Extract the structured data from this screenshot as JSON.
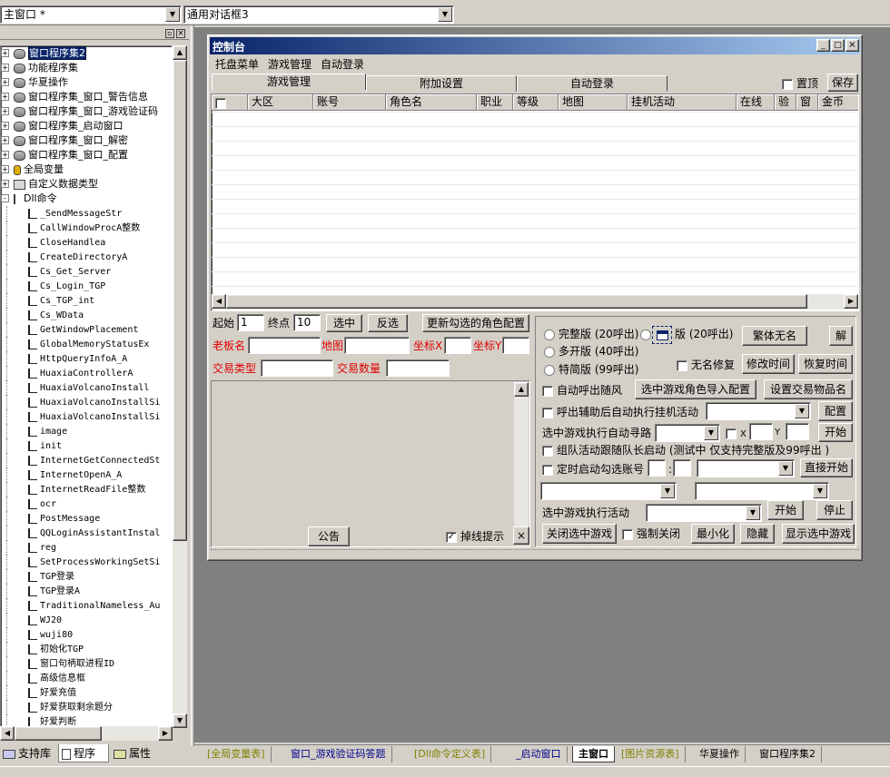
{
  "toolbar": {
    "window_select": "主窗口 *",
    "dialog_select": "通用对话框3"
  },
  "tree": {
    "items": [
      {
        "label": "窗口程序集2",
        "level": 0,
        "icon": "module-icon",
        "expand": "+",
        "selected": true
      },
      {
        "label": "功能程序集",
        "level": 0,
        "icon": "module-icon",
        "expand": "+"
      },
      {
        "label": "华夏操作",
        "level": 0,
        "icon": "module-icon",
        "expand": "+"
      },
      {
        "label": "窗口程序集_窗口_警告信息",
        "level": 0,
        "icon": "module-icon",
        "expand": "+"
      },
      {
        "label": "窗口程序集_窗口_游戏验证码",
        "level": 0,
        "icon": "module-icon",
        "expand": "+"
      },
      {
        "label": "窗口程序集_启动窗口",
        "level": 0,
        "icon": "module-icon",
        "expand": "+"
      },
      {
        "label": "窗口程序集_窗口_解密",
        "level": 0,
        "icon": "module-icon",
        "expand": "+"
      },
      {
        "label": "窗口程序集_窗口_配置",
        "level": 0,
        "icon": "module-icon",
        "expand": "+"
      },
      {
        "label": "全局变量",
        "level": 0,
        "icon": "database-icon",
        "expand": "+"
      },
      {
        "label": "自定义数据类型",
        "level": 0,
        "icon": "datatype-icon",
        "expand": "+"
      },
      {
        "label": "Dll命令",
        "level": 0,
        "icon": "dll-icon",
        "expand": "-"
      },
      {
        "label": "_SendMessageStr",
        "level": 1,
        "mono": true
      },
      {
        "label": "CallWindowProcA整数",
        "level": 1,
        "mono": true
      },
      {
        "label": "CloseHandlea",
        "level": 1,
        "mono": true
      },
      {
        "label": "CreateDirectoryA",
        "level": 1,
        "mono": true
      },
      {
        "label": "Cs_Get_Server",
        "level": 1,
        "mono": true
      },
      {
        "label": "Cs_Login_TGP",
        "level": 1,
        "mono": true
      },
      {
        "label": "Cs_TGP_int",
        "level": 1,
        "mono": true
      },
      {
        "label": "Cs_WData",
        "level": 1,
        "mono": true
      },
      {
        "label": "GetWindowPlacement",
        "level": 1,
        "mono": true
      },
      {
        "label": "GlobalMemoryStatusEx",
        "level": 1,
        "mono": true
      },
      {
        "label": "HttpQueryInfoA_A",
        "level": 1,
        "mono": true
      },
      {
        "label": "HuaxiaControllerA",
        "level": 1,
        "mono": true
      },
      {
        "label": "HuaxiaVolcanoInstall",
        "level": 1,
        "mono": true
      },
      {
        "label": "HuaxiaVolcanoInstallSi",
        "level": 1,
        "mono": true
      },
      {
        "label": "HuaxiaVolcanoInstallSi",
        "level": 1,
        "mono": true
      },
      {
        "label": "image",
        "level": 1,
        "mono": true
      },
      {
        "label": "init",
        "level": 1,
        "mono": true
      },
      {
        "label": "InternetGetConnectedSt",
        "level": 1,
        "mono": true
      },
      {
        "label": "InternetOpenA_A",
        "level": 1,
        "mono": true
      },
      {
        "label": "InternetReadFile整数",
        "level": 1,
        "mono": true
      },
      {
        "label": "ocr",
        "level": 1,
        "mono": true
      },
      {
        "label": "PostMessage",
        "level": 1,
        "mono": true
      },
      {
        "label": "QQLoginAssistantInstal",
        "level": 1,
        "mono": true
      },
      {
        "label": "reg",
        "level": 1,
        "mono": true
      },
      {
        "label": "SetProcessWorkingSetSi",
        "level": 1,
        "mono": true
      },
      {
        "label": "TGP登录",
        "level": 1,
        "mono": true
      },
      {
        "label": "TGP登录A",
        "level": 1,
        "mono": true
      },
      {
        "label": "TraditionalNameless_Au",
        "level": 1,
        "mono": true
      },
      {
        "label": "WJ20",
        "level": 1,
        "mono": true
      },
      {
        "label": "wuji80",
        "level": 1,
        "mono": true
      },
      {
        "label": "初始化TGP",
        "level": 1,
        "mono": true
      },
      {
        "label": "窗口句柄取进程ID",
        "level": 1,
        "mono": true
      },
      {
        "label": "高级信息框",
        "level": 1,
        "mono": true
      },
      {
        "label": "好爱充值",
        "level": 1,
        "mono": true
      },
      {
        "label": "好爱获取剩余题分",
        "level": 1,
        "mono": true
      },
      {
        "label": "好爱判断",
        "level": 1,
        "mono": true
      }
    ]
  },
  "left_tabs": {
    "support": "支持库",
    "program": "程序",
    "property": "属性"
  },
  "window": {
    "title": "控制台",
    "menu": [
      "托盘菜单",
      "游戏管理",
      "自动登录"
    ],
    "tabs": [
      "游戏管理",
      "附加设置",
      "自动登录"
    ],
    "top_check": "置顶",
    "save": "保存",
    "columns": [
      "大区",
      "账号",
      "角色名",
      "职业",
      "等级",
      "地图",
      "挂机活动",
      "在线",
      "验",
      "窗",
      "金币"
    ],
    "row1": {
      "start_label": "起始",
      "start_value": "1",
      "end_label": "终点",
      "end_value": "10",
      "select_btn": "选中",
      "invert_btn": "反选",
      "update_btn": "更新勾选的角色配置"
    },
    "row2": {
      "boss": "老板名",
      "map": "地图",
      "coord_x": "坐标X",
      "coord_y": "坐标Y"
    },
    "row3": {
      "trade_type": "交易类型",
      "trade_qty": "交易数量"
    },
    "notice_btn": "公告",
    "disconnect_check": "掉线提示",
    "close_x": "×",
    "right": {
      "radio_full": "完整版 (20呼出)",
      "radio_multi": "多开版 (40呼出)",
      "radio_special": "特简版 (99呼出)",
      "radio_hidden": "版 (20呼出)",
      "btn_fanti": "繁体无名",
      "btn_jie": "解",
      "check_wuming": "无名修复",
      "btn_modify_time": "修改时间",
      "btn_restore_time": "恢复时间",
      "check_auto_call": "自动呼出随风",
      "btn_import": "选中游戏角色导入配置",
      "btn_trade_items": "设置交易物品名",
      "check_assist": "呼出辅助后自动执行挂机活动",
      "btn_config": "配置",
      "label_pathfind": "选中游戏执行自动寻路",
      "label_x": "X",
      "label_y": "Y",
      "btn_start1": "开始",
      "check_team": "组队活动跟随队长启动 (测试中 仅支持完整版及99呼出 )",
      "check_timer": "定时启动勾选账号",
      "colon": ":",
      "btn_direct": "直接开始",
      "label_activity": "选中游戏执行活动",
      "btn_start2": "开始",
      "btn_stop": "停止",
      "btn_close_game": "关闭选中游戏",
      "check_force": "强制关闭",
      "btn_minimize": "最小化",
      "btn_hide": "隐藏",
      "btn_show": "显示选中游戏"
    }
  },
  "bottom_tabs": [
    {
      "label": "[全局变量表]",
      "style": "olive"
    },
    {
      "label": "窗口_游戏验证码答题",
      "style": "blue"
    },
    {
      "label": "[Dll命令定义表]",
      "style": "olive"
    },
    {
      "label": "_启动窗口",
      "style": "blue"
    },
    {
      "label": "主窗口",
      "style": "active"
    },
    {
      "label": "[图片资源表]",
      "style": "olive"
    },
    {
      "label": "华夏操作",
      "style": "normal"
    },
    {
      "label": "窗口程序集2",
      "style": "normal"
    }
  ]
}
